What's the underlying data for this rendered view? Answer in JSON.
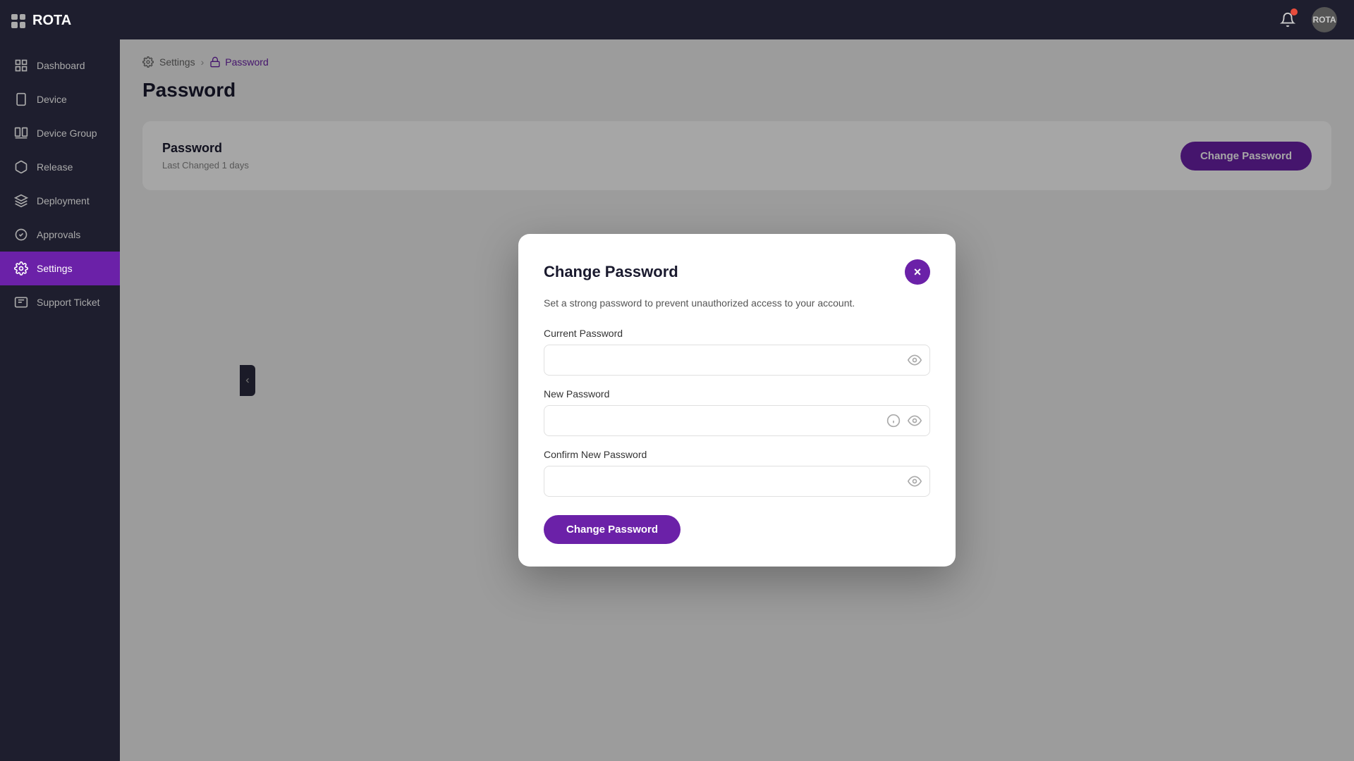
{
  "app": {
    "name": "ROTA"
  },
  "sidebar": {
    "collapse_label": "Collapse",
    "items": [
      {
        "id": "dashboard",
        "label": "Dashboard",
        "icon": "dashboard-icon",
        "active": false
      },
      {
        "id": "device",
        "label": "Device",
        "icon": "device-icon",
        "active": false
      },
      {
        "id": "device-group",
        "label": "Device Group",
        "icon": "device-group-icon",
        "active": false
      },
      {
        "id": "release",
        "label": "Release",
        "icon": "release-icon",
        "active": false
      },
      {
        "id": "deployment",
        "label": "Deployment",
        "icon": "deployment-icon",
        "active": false
      },
      {
        "id": "approvals",
        "label": "Approvals",
        "icon": "approvals-icon",
        "active": false
      },
      {
        "id": "settings",
        "label": "Settings",
        "icon": "settings-icon",
        "active": true
      },
      {
        "id": "support-ticket",
        "label": "Support Ticket",
        "icon": "support-icon",
        "active": false
      }
    ]
  },
  "topbar": {
    "avatar_label": "ROTA",
    "notifications_count": 1
  },
  "breadcrumb": {
    "parent": "Settings",
    "current": "Password"
  },
  "page": {
    "title": "Password"
  },
  "password_card": {
    "title": "Password",
    "subtitle": "Last Changed 1 days",
    "change_button_label": "Change Password"
  },
  "modal": {
    "title": "Change Password",
    "description": "Set a strong password to prevent unauthorized access to your account.",
    "current_password_label": "Current Password",
    "current_password_placeholder": "",
    "new_password_label": "New Password",
    "new_password_placeholder": "",
    "confirm_password_label": "Confirm New Password",
    "confirm_password_placeholder": "",
    "submit_button_label": "Change Password",
    "close_icon": "×"
  }
}
